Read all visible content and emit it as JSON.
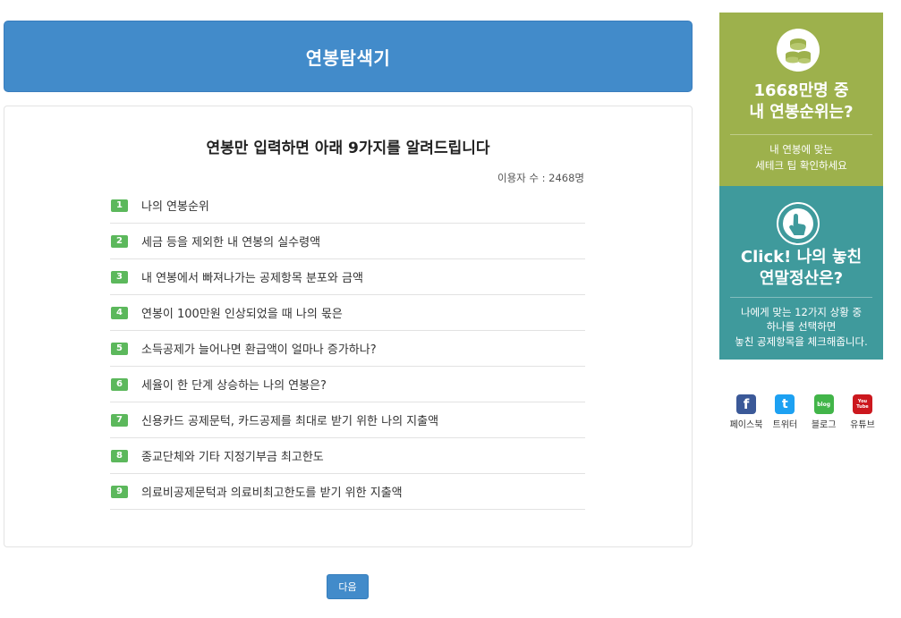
{
  "header": {
    "title": "연봉탐색기"
  },
  "panel": {
    "heading": "연봉만 입력하면 아래 9가지를 알려드립니다",
    "user_count": "이용자 수 : 2468명",
    "items": [
      {
        "num": "1",
        "text": "나의 연봉순위"
      },
      {
        "num": "2",
        "text": "세금 등을 제외한 내 연봉의 실수령액"
      },
      {
        "num": "3",
        "text": "내 연봉에서 빠져나가는 공제항목 분포와 금액"
      },
      {
        "num": "4",
        "text": "연봉이 100만원 인상되었을 때 나의 몫은"
      },
      {
        "num": "5",
        "text": "소득공제가 늘어나면 환급액이 얼마나 증가하나?"
      },
      {
        "num": "6",
        "text": "세율이 한 단계 상승하는 나의 연봉은?"
      },
      {
        "num": "7",
        "text": "신용카드 공제문턱, 카드공제를 최대로 받기 위한 나의 지출액"
      },
      {
        "num": "8",
        "text": "종교단체와 기타 지정기부금 최고한도"
      },
      {
        "num": "9",
        "text": "의료비공제문턱과 의료비최고한도를 받기 위한 지출액"
      }
    ]
  },
  "next_button": "다음",
  "sidebar": {
    "rank_ad": {
      "title_line1": "1668만명 중",
      "title_line2": "내 연봉순위는?",
      "desc_line1": "내 연봉에 맞는",
      "desc_line2": "세테크 팁 확인하세요",
      "icon": "coins-icon",
      "color": "#9db14c"
    },
    "click_ad": {
      "title_line1": "Click! 나의 놓친",
      "title_line2": "연말정산은?",
      "desc_line1": "나에게 맞는 12가지 상황 중",
      "desc_line2": "하나를 선택하면",
      "desc_line3": "놓친 공제항목을 체크해줍니다.",
      "icon": "touch-hand-icon",
      "color": "#3f9a9c"
    }
  },
  "social": {
    "facebook": {
      "label": "페이스북",
      "glyph": "f",
      "color": "#3b5998"
    },
    "twitter": {
      "label": "트위터",
      "glyph": "t",
      "color": "#1da1f2"
    },
    "blog": {
      "label": "블로그",
      "glyph": "blog",
      "color": "#42b549"
    },
    "youtube": {
      "label": "유튜브",
      "glyph": "You Tube",
      "color": "#cc181e"
    }
  }
}
